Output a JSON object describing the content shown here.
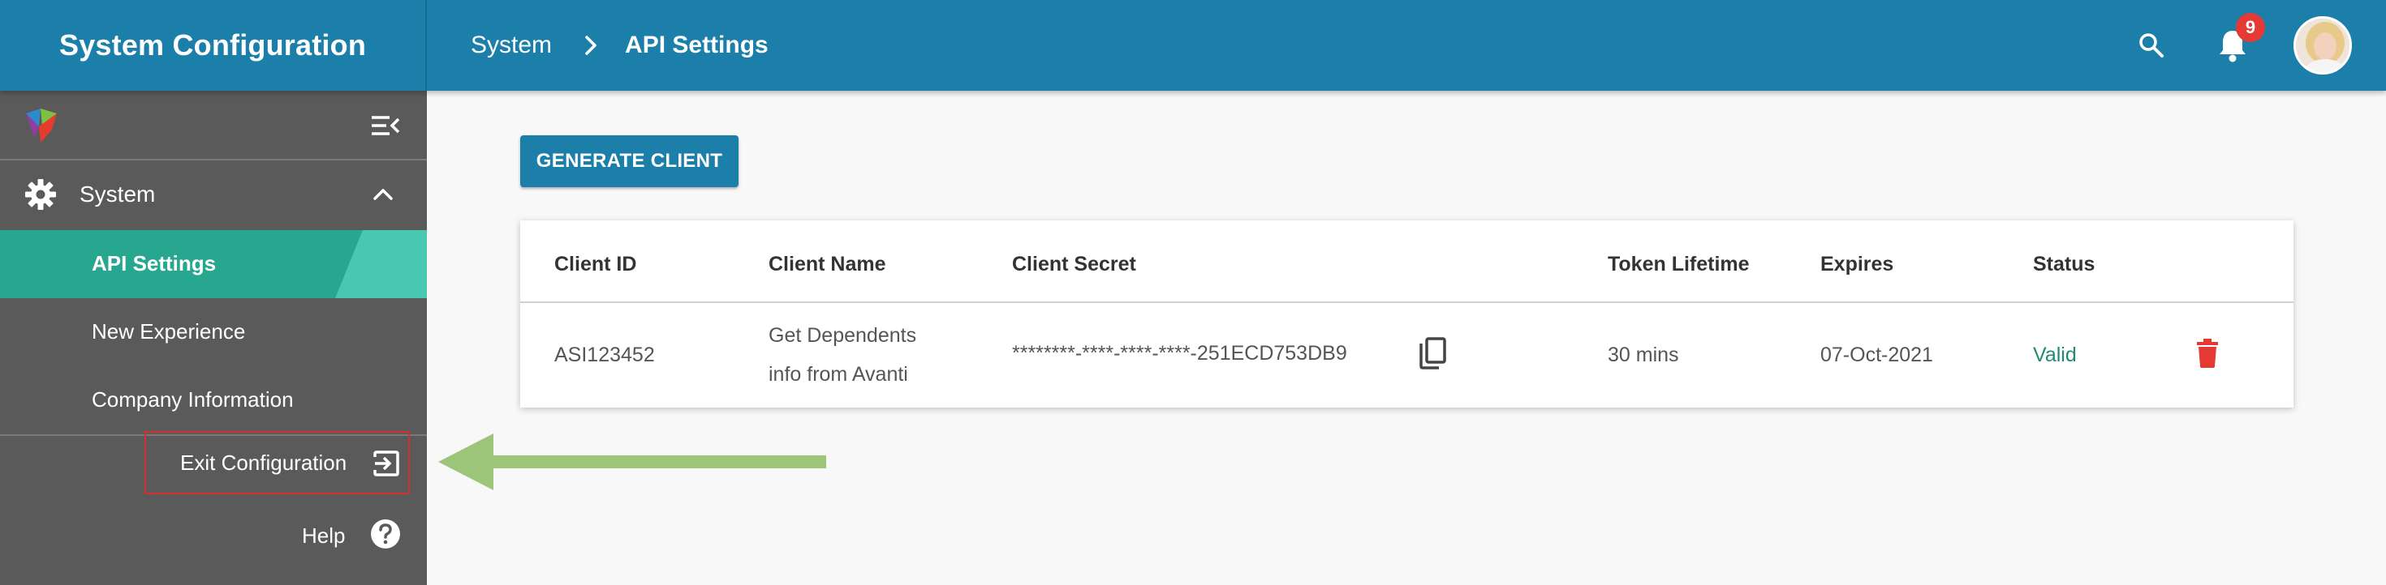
{
  "header": {
    "app_title": "System Configuration",
    "breadcrumb": [
      "System",
      "API Settings"
    ],
    "notification_count": "9",
    "icons": [
      "search-icon",
      "bell-icon",
      "user-avatar"
    ]
  },
  "sidebar": {
    "section_label": "System",
    "items": [
      {
        "label": "API Settings",
        "active": true
      },
      {
        "label": "New Experience",
        "active": false
      },
      {
        "label": "Company Information",
        "active": false
      }
    ],
    "exit_label": "Exit Configuration",
    "help_label": "Help"
  },
  "main": {
    "generate_button": "GENERATE CLIENT",
    "table": {
      "columns": [
        "Client ID",
        "Client Name",
        "Client Secret",
        "Token Lifetime",
        "Expires",
        "Status"
      ],
      "rows": [
        {
          "client_id": "ASI123452",
          "client_name_line1": "Get Dependents",
          "client_name_line2": "info from Avanti",
          "client_secret": "********-****-****-****-251ECD753DB9",
          "token_lifetime": "30 mins",
          "expires": "07-Oct-2021",
          "status": "Valid"
        }
      ]
    }
  },
  "colors": {
    "header": "#1b7fa9",
    "sidebar": "#5a5a5a",
    "active_item": "#27a690",
    "status_valid": "#1f8a74",
    "delete": "#e53935",
    "annotation_arrow": "#9dc57a",
    "annotation_box": "#d32f2f"
  }
}
